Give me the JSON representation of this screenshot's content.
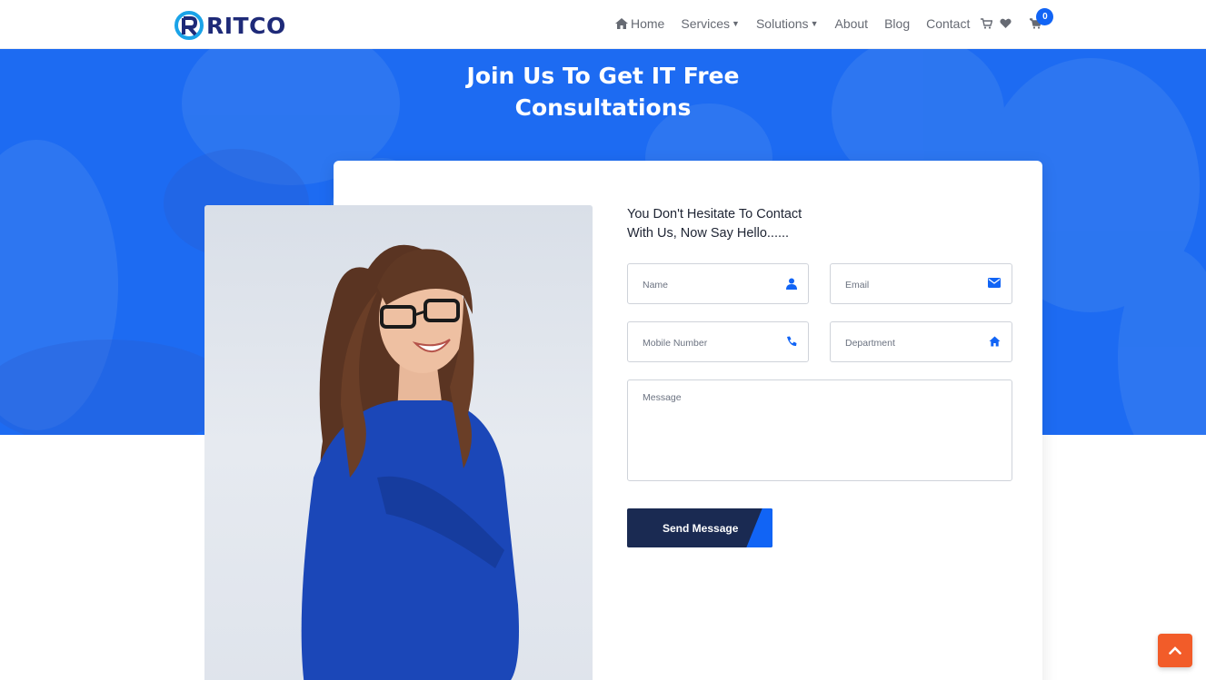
{
  "brand": {
    "name": "RITCO"
  },
  "nav": {
    "home": "Home",
    "services": "Services",
    "solutions": "Solutions",
    "about": "About",
    "blog": "Blog",
    "contact": "Contact",
    "cart_count": "0"
  },
  "hero": {
    "title_line1": "Join Us To Get IT Free",
    "title_line2": "Consultations"
  },
  "form": {
    "heading_line1": "You Don't Hesitate To Contact",
    "heading_line2": "With Us, Now Say Hello......",
    "name_placeholder": "Name",
    "email_placeholder": "Email",
    "mobile_placeholder": "Mobile Number",
    "department_placeholder": "Department",
    "message_placeholder": "Message",
    "submit_label": "Send Message"
  },
  "colors": {
    "primary": "#1d6bf2",
    "navy": "#1a2a52",
    "accent": "#f25c29"
  }
}
